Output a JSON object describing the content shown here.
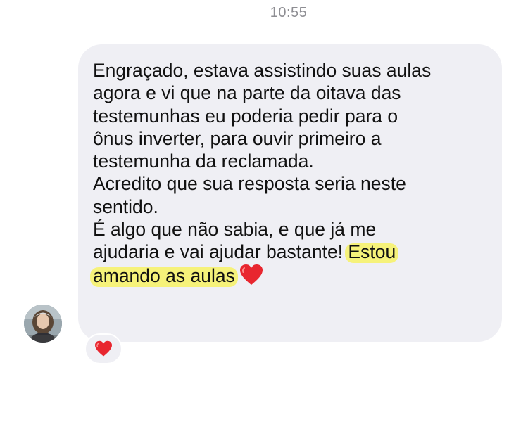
{
  "conversation": {
    "timestamp": "10:55"
  },
  "message": {
    "paragraphs": [
      {
        "lines": [
          "Engraçado, estava assistindo suas aulas",
          "agora e vi que na parte da oitava das",
          "testemunhas eu poderia pedir para o",
          "ônus inverter, para ouvir primeiro a",
          "testemunha da reclamada."
        ]
      },
      {
        "lines": [
          "Acredito que sua resposta seria neste",
          "sentido."
        ]
      },
      {
        "line1": "É algo que não sabia, e que já me",
        "line2_plain": "ajudaria e vai ajudar bastante! ",
        "line2_highlighted": "Estou",
        "line3_highlighted": "amando as aulas",
        "emoji_icon": "red-heart-icon"
      }
    ]
  },
  "sender": {
    "avatar_icon": "profile-photo"
  },
  "reaction": {
    "icon": "red-heart-icon"
  },
  "colors": {
    "bubble": "#efeff4",
    "text": "#111111",
    "timestamp": "#8e8e93",
    "highlight": "#f6f27a",
    "heart": "#e8262f"
  }
}
